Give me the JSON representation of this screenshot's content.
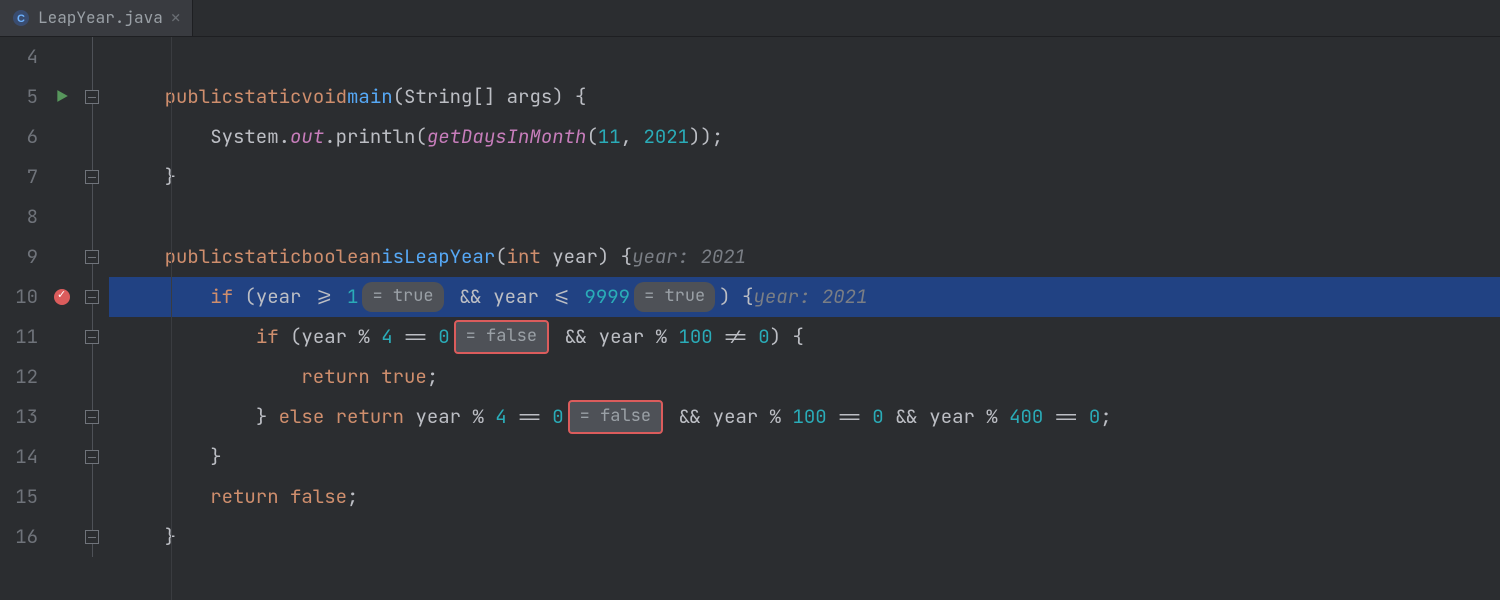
{
  "tab": {
    "filename": "LeapYear.java"
  },
  "gutter": {
    "lines": [
      "4",
      "5",
      "6",
      "7",
      "8",
      "9",
      "10",
      "11",
      "12",
      "13",
      "14",
      "15",
      "16"
    ],
    "runAt": "5",
    "breakpointAt": "10",
    "foldAt": [
      "5",
      "7",
      "9",
      "10",
      "11",
      "13",
      "14",
      "16"
    ]
  },
  "hints": {
    "true": "= true",
    "false": "= false"
  },
  "hintComments": {
    "year": "year: 2021"
  },
  "code": {
    "l5": {
      "kw1": "public",
      "kw2": "static",
      "kw3": "void",
      "fn": "main",
      "arg": "(String[] args) {"
    },
    "l6": {
      "pre": "System.",
      "out": "out",
      "mid": ".println(",
      "call": "getDaysInMonth",
      "args": "(",
      "n1": "11",
      "c": ", ",
      "n2": "2021",
      "end": "));"
    },
    "l7": {
      "brace": "}"
    },
    "l9": {
      "kw1": "public",
      "kw2": "static",
      "kw3": "boolean",
      "fn": "isLeapYear",
      "sig": "(",
      "ty": "int",
      "argn": " year) {"
    },
    "l10": {
      "kw": "if",
      "a": " (year >= ",
      "n1": "1",
      "mid": " && year <= ",
      "n2": "9999",
      "end": ") {"
    },
    "l11": {
      "kw": "if",
      "a": " (year % ",
      "n1": "4",
      "b": " == ",
      "n2": "0",
      "c": " && year % ",
      "n3": "100",
      "d": " != ",
      "n4": "0",
      "e": ") {"
    },
    "l12": {
      "kw": "return",
      "v": " true",
      "e": ";"
    },
    "l13": {
      "a": "} ",
      "kw1": "else",
      "sp": " ",
      "kw2": "return",
      "b": " year % ",
      "n1": "4",
      "c": " == ",
      "n2": "0",
      "d": " && year % ",
      "n3": "100",
      "e": " == ",
      "n4": "0",
      "f": " && year % ",
      "n5": "400",
      "g": " == ",
      "n6": "0",
      "h": ";"
    },
    "l14": {
      "brace": "}"
    },
    "l15": {
      "kw": "return",
      "v": " false",
      "e": ";"
    },
    "l16": {
      "brace": "}"
    }
  }
}
